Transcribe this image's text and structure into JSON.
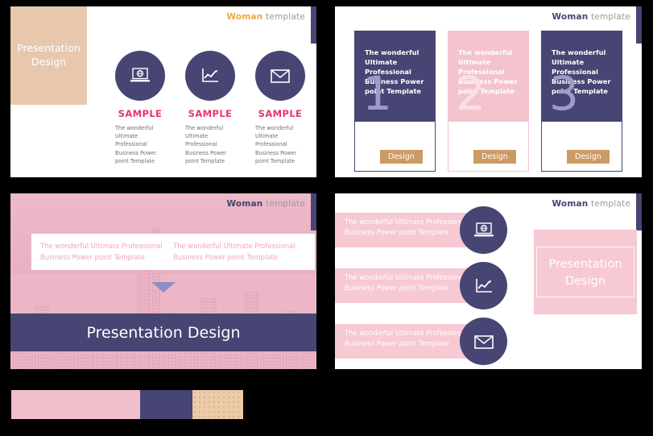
{
  "brand": {
    "name": "Woman",
    "suffix": "template"
  },
  "slide1": {
    "name": "icons-sample-slide",
    "panel_title": "Presentation\nDesign",
    "panel_title_line1": "Presentation",
    "panel_title_line2": "Design",
    "items": [
      {
        "icon": "laptop-globe-icon",
        "title": "SAMPLE",
        "body": "The wonderful Ultimate Professional Business Power point Template"
      },
      {
        "icon": "line-chart-icon",
        "title": "SAMPLE",
        "body": "The wonderful Ultimate Professional Business Power point Template"
      },
      {
        "icon": "envelope-icon",
        "title": "SAMPLE",
        "body": "The wonderful Ultimate Professional Business Power point Template"
      }
    ]
  },
  "slide2": {
    "name": "three-columns-slide",
    "columns": [
      {
        "text": "The wonderful Ultimate Professional Business Power point Template",
        "number": "1",
        "button": "Design",
        "theme": "navy"
      },
      {
        "text": "The wonderful Ultimate Professional Business Power point Template",
        "number": "2",
        "button": "Design",
        "theme": "pink"
      },
      {
        "text": "The wonderful Ultimate Professional Business Power point Template",
        "number": "3",
        "button": "Design",
        "theme": "navy"
      }
    ]
  },
  "slide3": {
    "name": "cityscape-banner-slide",
    "boxes": [
      {
        "text": "The wonderful Ultimate Professional Business Power point Template"
      },
      {
        "text": "The wonderful Ultimate Professional Business Power point Template"
      }
    ],
    "banner_title": "Presentation Design"
  },
  "slide4": {
    "name": "icon-list-slide",
    "rows": [
      {
        "icon": "laptop-globe-icon",
        "text": "The wonderful Ultimate Professional Business Power point Template"
      },
      {
        "icon": "line-chart-icon",
        "text": "The wonderful Ultimate Professional Business Power point Template"
      },
      {
        "icon": "envelope-icon",
        "text": "The wonderful Ultimate Professional Business Power point Template"
      }
    ],
    "callout_line1": "Presentation",
    "callout_line2": "Design"
  },
  "palette": {
    "swatches": [
      {
        "name": "pink",
        "hex": "#f0bfcb"
      },
      {
        "name": "navy",
        "hex": "#474573"
      },
      {
        "name": "tan",
        "hex": "#eccba9"
      }
    ]
  },
  "colors": {
    "navy": "#474573",
    "pink": "#f4c4ce",
    "tan": "#e7c8ad",
    "gold": "#cc9a64",
    "crimson": "#e8366b",
    "brand_gold": "#eda93c",
    "brand_gray": "#9a9a9a"
  }
}
